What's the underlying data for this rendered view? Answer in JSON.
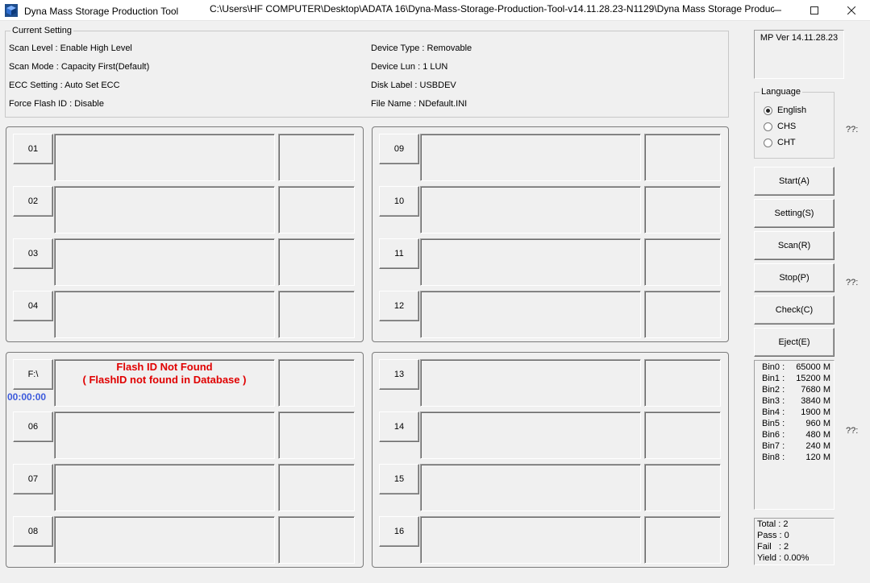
{
  "window": {
    "app_title": "Dyna Mass Storage Production Tool",
    "path": "C:\\Users\\HF COMPUTER\\Desktop\\ADATA 16\\Dyna-Mass-Storage-Production-Tool-v14.11.28.23-N1129\\Dyna Mass Storage Produc...",
    "minimize_icon": "minimize-icon",
    "maximize_icon": "maximize-icon",
    "close_icon": "close-icon"
  },
  "current_setting": {
    "legend": "Current Setting",
    "scan_level": "Scan Level : Enable High Level",
    "scan_mode": "Scan Mode : Capacity First(Default)",
    "ecc_setting": "ECC Setting : Auto Set ECC",
    "force_flash_id": "Force Flash ID : Disable",
    "device_type": "Device Type : Removable",
    "device_lun": "Device Lun : 1 LUN",
    "disk_label": "Disk Label : USBDEV",
    "file_name": "File Name : NDefault.INI"
  },
  "ports": {
    "p01": "01",
    "p02": "02",
    "p03": "03",
    "p04": "04",
    "p05": "F:\\",
    "p06": "06",
    "p07": "07",
    "p08": "08",
    "p09": "09",
    "p10": "10",
    "p11": "11",
    "p12": "12",
    "p13": "13",
    "p14": "14",
    "p15": "15",
    "p16": "16"
  },
  "port05_status": {
    "line1": "Flash ID Not Found",
    "line2": "( FlashID not found in Database )",
    "timer": "00:00:00",
    "message_color": "#e00000",
    "timer_color": "#3c5adc"
  },
  "mp_version": "MP Ver 14.11.28.23",
  "language": {
    "legend": "Language",
    "options": [
      "English",
      "CHS",
      "CHT"
    ],
    "selected": "English"
  },
  "side_marks": [
    "??:",
    "??:",
    "??:"
  ],
  "buttons": {
    "start": "Start(A)",
    "setting": "Setting(S)",
    "scan": "Scan(R)",
    "stop": "Stop(P)",
    "check": "Check(C)",
    "eject": "Eject(E)"
  },
  "bins": [
    {
      "name": "Bin0 :",
      "value": "65000 M"
    },
    {
      "name": "Bin1 :",
      "value": "15200 M"
    },
    {
      "name": "Bin2 :",
      "value": "7680 M"
    },
    {
      "name": "Bin3 :",
      "value": "3840 M"
    },
    {
      "name": "Bin4 :",
      "value": "1900 M"
    },
    {
      "name": "Bin5 :",
      "value": "960 M"
    },
    {
      "name": "Bin6 :",
      "value": "480 M"
    },
    {
      "name": "Bin7 :",
      "value": "240 M"
    },
    {
      "name": "Bin8 :",
      "value": "120 M"
    }
  ],
  "stats": {
    "total": "Total : 2",
    "pass": "Pass : 0",
    "fail": "Fail   : 2",
    "yield": "Yield : 0.00%"
  }
}
